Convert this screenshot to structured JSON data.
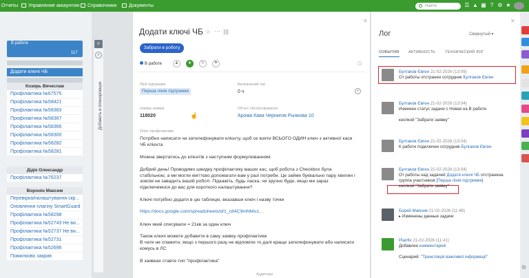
{
  "topbar": {
    "items": [
      "Отчеты",
      "Управление аккаунтом",
      "Справочники",
      "Документы"
    ],
    "search_placeholder": "Найти"
  },
  "left": {
    "column_title": "В работе",
    "column_count": "117",
    "dragged_task": "Додати ключі ЧБ",
    "groups": [
      {
        "title": "Козирь Вячеслав",
        "tasks": [
          "Профілактика №67575",
          "Профілактика №58421",
          "Профілактика №58383",
          "Профілактика №58367",
          "Профілактика №58366",
          "Профілактика №58300",
          "Профілактика №58282",
          "Профілактика №58281"
        ]
      },
      {
        "title": "Дідік Олександр",
        "tasks": [
          "Профілактика №76237"
        ]
      },
      {
        "title": "Воронін Максим",
        "tasks": [
          "Перевірка/налаштування скр...",
          "Оновлення плагіну SmartGuard",
          "Профілактика №58298",
          "Профілактика №52743 Не ви...",
          "Профілактика №52737 Не ви...",
          "Профілактика №52731",
          "Профілактика №52696",
          "Помилково закрив"
        ]
      }
    ]
  },
  "planner": {
    "label": "Добавить в планировщик"
  },
  "card": {
    "title": "Додати ключі ЧБ",
    "take_button": "Забрати в роботу",
    "status": "В работе",
    "fields": {
      "support_line_label": "Лінії підтримки",
      "support_line_value": "Перша лінія підтримки",
      "time_spent_label": "Витрачений час",
      "time_spent_value": "0 ч",
      "request_number_label": "Номер заявки",
      "request_number_value": "118020",
      "service_object_label": "Об'єкт обслуговування",
      "service_object_value": "Арома Кава Чернигов Рынкова 10",
      "description_label": "Опис профілактики",
      "auditors_label": "Аудитори"
    },
    "description": [
      "Потрібно написати чи зателефонувати клієнту, щоб се взяти ВСЬОГО ОДИН ключ з активної каси ЧБ клієнта",
      "Можна звертатись до клієнтів з наступним формулюванням:",
      "Добрий день! Проводимо швидку профілактику ваших кас, щоб робота з Checkbox була стабільною, а ми могли миттєво допомагати вам у разі потреби. Це займе буквально пару хвилин і зовсім не завадить вашій роботі. Підкажіть, будь ласка, чи зручно буде, якщо ми зараз підключимося до вас для короткого налаштування?",
      "Ключі потрібно додати в цю таблицю, вказавши ключ і назву точки",
      "https://docs.google.com/spreadsheets/d/1_c84C9mNMo1...",
      "Ключ який списували = 21кв за один ключ",
      "Також ключі можете добавити в саму заявку профілактики",
      "В чати не спамити, якщо з першого разу не відповіли то далі краще зателефонувати або написати комусь в ЛС",
      "В заявках ставте тип \"профілактика\""
    ]
  },
  "log": {
    "title": "Лог",
    "sort": "Свернутый",
    "tabs": [
      "СОБЫТИЯ",
      "АКТИВНОСТЬ",
      "ТЕХНИЧЕСКИЙ ЛОГ"
    ],
    "entries": [
      {
        "author": "Булгаков Євген",
        "time": "21-02-2026 (13:09)",
        "text": "От работы отстранен сотрудник",
        "link": "Булгаков Євген"
      },
      {
        "author": "Булгаков Євген",
        "time": "21-02-2026 (13:04)",
        "text": "Изменен статус задачи  c Новая на В работе",
        "extra": "кнопкой \"Забрати заявку\""
      },
      {
        "author": "Булгаков Євген",
        "time": "21-02-2026 (13:04)",
        "text": "К работе подключен сотрудник",
        "link": "Булгаков Євген"
      },
      {
        "author": "Булгаков Євген",
        "time": "21-02-2026 (13:04)",
        "text": "От работы над задачей",
        "link": "Додати ключі ЧБ",
        "text2": "отстранена группа участников",
        "link2": "[Перша лінія підтримки]",
        "extra": "кнопкой \"Забрати заявку\""
      },
      {
        "author": "Борей Максим",
        "time": "21-02-2026 (11:48)",
        "text": "▸ Изменены данные задачи"
      },
      {
        "author": "Planfix",
        "time": "21-02-2026 (11:41)",
        "text": "Добавлен",
        "link": "комментарий",
        "text2": "Сценарий:",
        "link2": "\"Трансляція важливої інформації\""
      }
    ]
  }
}
